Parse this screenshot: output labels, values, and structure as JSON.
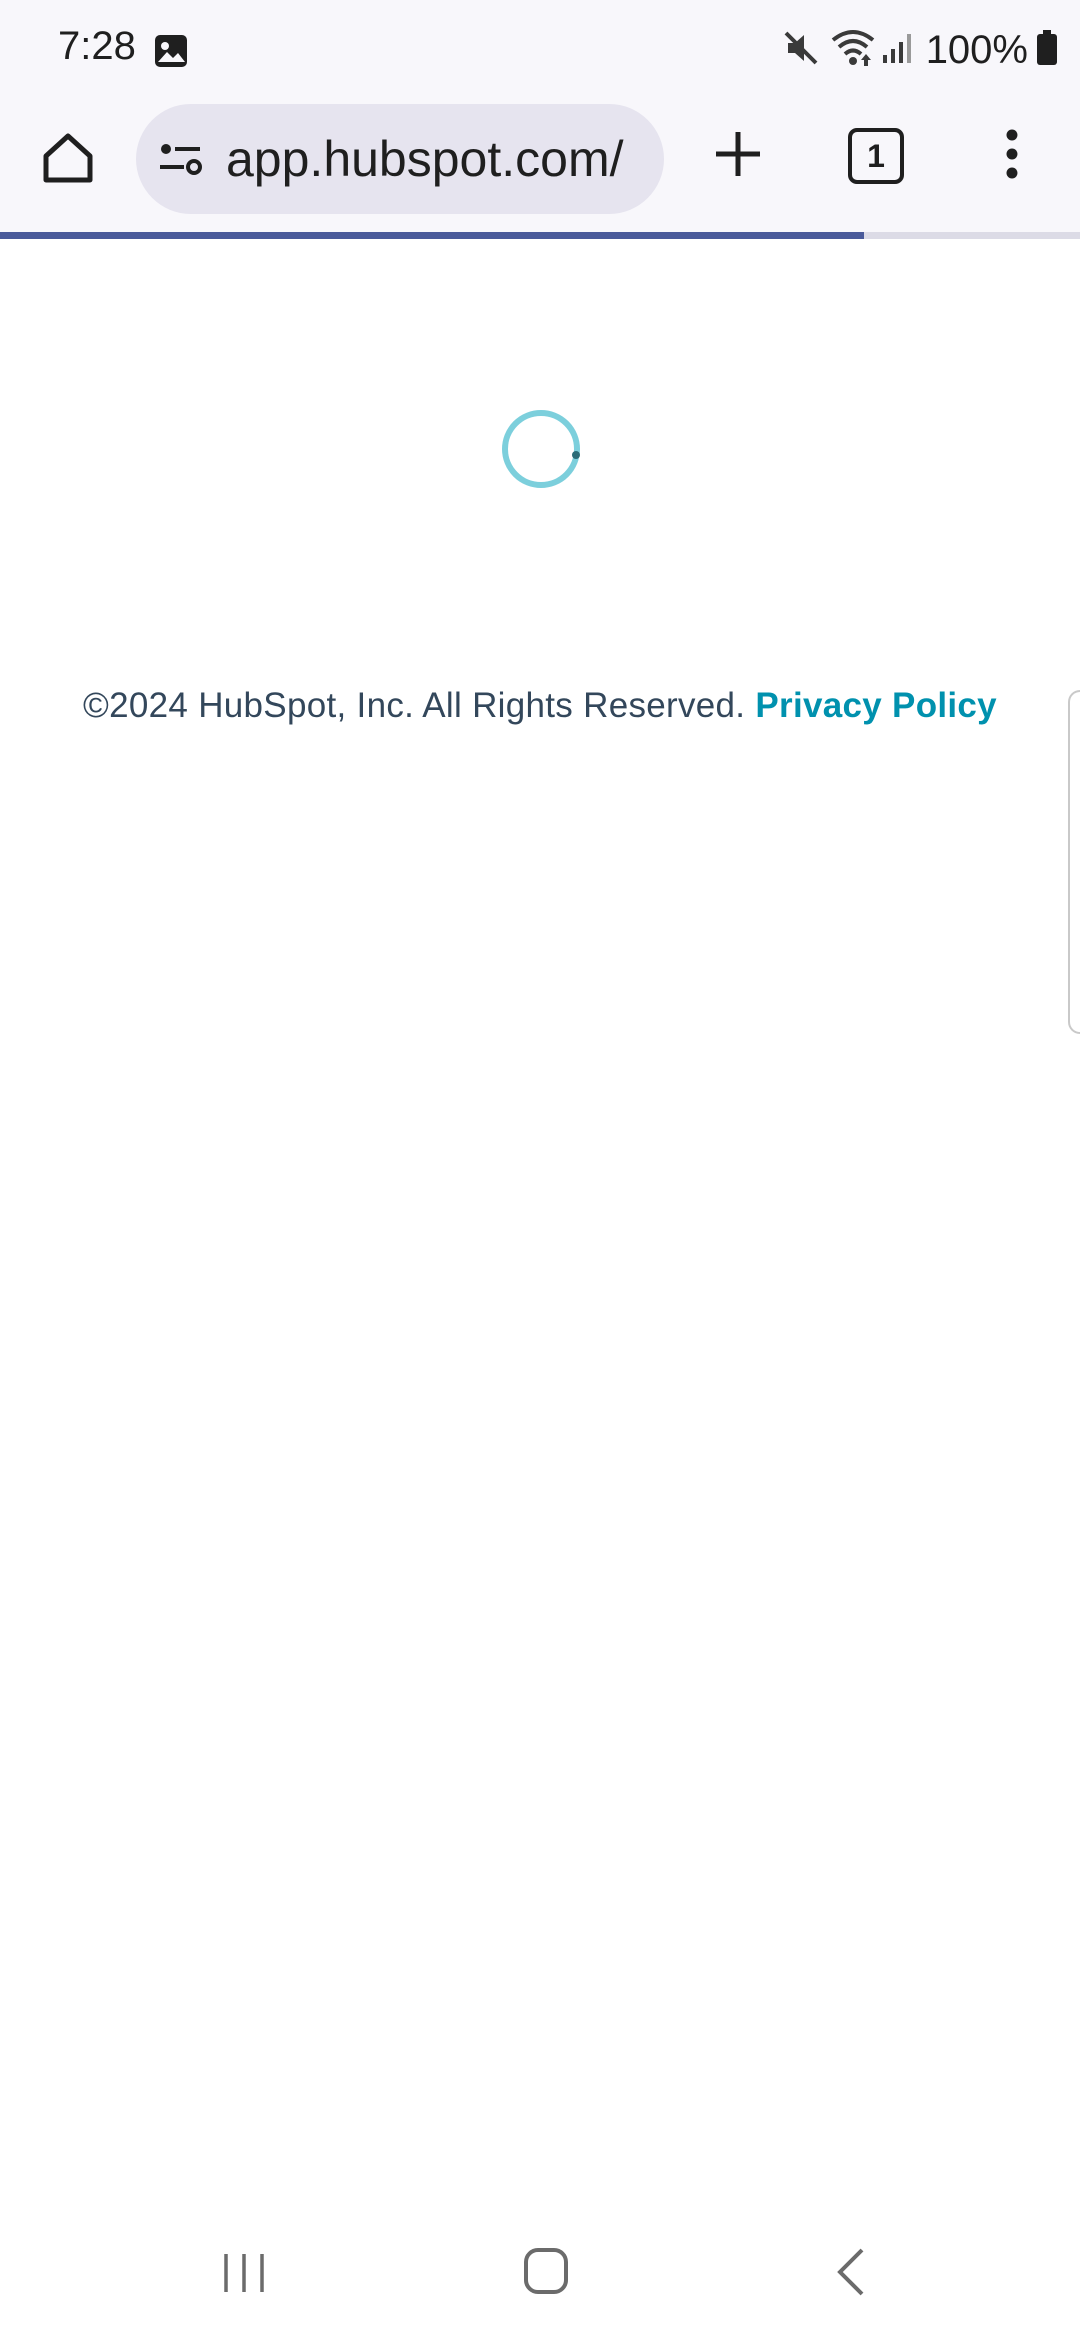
{
  "status_bar": {
    "time": "7:28",
    "battery": "100%",
    "icons": [
      "image-notification-icon",
      "mute-icon",
      "wifi-icon",
      "signal-icon",
      "battery-icon"
    ]
  },
  "browser": {
    "url": "app.hubspot.com/",
    "tab_count": "1",
    "load_progress": 0.8,
    "icons": [
      "home-icon",
      "site-settings-icon",
      "plus-icon",
      "tab-switcher-icon",
      "more-vert-icon"
    ]
  },
  "page": {
    "copyright": "©2024 HubSpot, Inc. All Rights Reserved.",
    "privacy_link": "Privacy Policy",
    "spinner_color": "#7ccfdc",
    "link_color": "#0091ae"
  },
  "nav_bar": {
    "icons": [
      "recents-icon",
      "home-icon",
      "back-icon"
    ]
  }
}
